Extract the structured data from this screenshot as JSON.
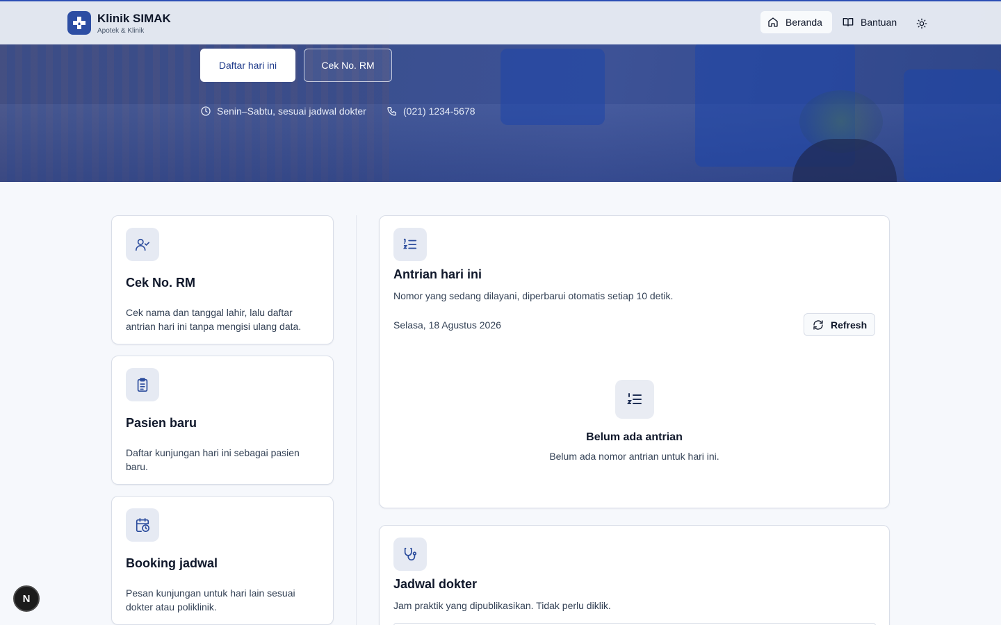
{
  "header": {
    "brand_name": "Klinik SIMAK",
    "brand_sub": "Apotek & Klinik",
    "nav": {
      "home": "Beranda",
      "help": "Bantuan"
    }
  },
  "hero": {
    "primary_button": "Daftar hari ini",
    "secondary_button": "Cek No. RM",
    "hours": "Senin–Sabtu, sesuai jadwal dokter",
    "phone": "(021) 1234-5678"
  },
  "side_cards": [
    {
      "title": "Cek No. RM",
      "desc": "Cek nama dan tanggal lahir, lalu daftar antrian hari ini tanpa mengisi ulang data.",
      "icon": "user-check-icon"
    },
    {
      "title": "Pasien baru",
      "desc": "Daftar kunjungan hari ini sebagai pasien baru.",
      "icon": "clipboard-icon"
    },
    {
      "title": "Booking jadwal",
      "desc": "Pesan kunjungan untuk hari lain sesuai dokter atau poliklinik.",
      "icon": "calendar-clock-icon"
    }
  ],
  "queue": {
    "title": "Antrian hari ini",
    "subtitle": "Nomor yang sedang dilayani, diperbarui otomatis setiap 10 detik.",
    "date": "Selasa, 18 Agustus 2026",
    "refresh_label": "Refresh",
    "empty_title": "Belum ada antrian",
    "empty_desc": "Belum ada nomor antrian untuk hari ini."
  },
  "schedule": {
    "title": "Jadwal dokter",
    "subtitle": "Jam praktik yang dipublikasikan. Tidak perlu diklik."
  },
  "dev_badge": "N",
  "colors": {
    "brand": "#2d4ea3",
    "accent_icon": "#2a4b9c",
    "hero_overlay": "#3a4f8f"
  }
}
